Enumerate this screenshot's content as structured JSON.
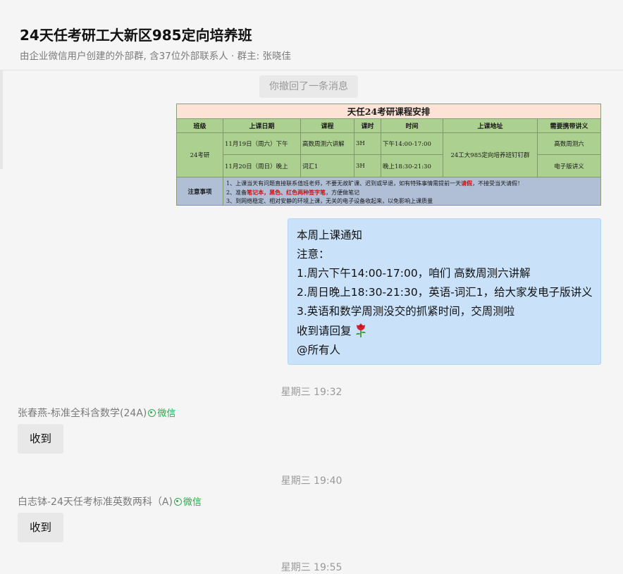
{
  "header": {
    "title": "24天任考研工大新区985定向培养班",
    "subtitle": "由企业微信用户创建的外部群, 含37位外部联系人 · 群主: 张晓佳"
  },
  "messages": {
    "revoke_notice": "你撤回了一条消息",
    "schedule": {
      "title": "天任24考研课程安排",
      "headers": [
        "班级",
        "上课日期",
        "课程",
        "课时",
        "时间",
        "上课地址",
        "需要携带讲义"
      ],
      "class_name": "24考研",
      "rows": [
        {
          "date": "11月19日（周六）下午",
          "course": "高数周测六讲解",
          "hours": "3H",
          "time": "下午14:00-17:00",
          "material": "高数周测六"
        },
        {
          "date": "11月20日（周日）晚上",
          "course": "词汇1",
          "hours": "3H",
          "time": "晚上18:30-21:30",
          "material": "电子版讲义"
        }
      ],
      "address": "24工大985定向培养班钉钉群",
      "notes_label": "注意事项",
      "note1_a": "1、上课当天有问题直接联系值班老师，不要无故旷课、迟到或早退，如有特殊事情需提前一天",
      "note1_red": "请假",
      "note1_b": "，不接受当天请假！",
      "note2_a": "2、准备",
      "note2_red": "笔记本，黑色、红色两种签字笔",
      "note2_b": "，方便做笔记",
      "note3": "3、到网络稳定、相对安静的环境上课，无关的电子设备收起来，以免影响上课质量"
    },
    "notice": {
      "lines": [
        "本周上课通知",
        "注意：",
        "1.周六下午14:00-17:00，咱们 高数周测六讲解",
        "2.周日晚上18:30-21:30，英语-词汇1，给大家发电子版讲义",
        "3.英语和数学周测没交的抓紧时间，交周测啦",
        "收到请回复",
        "@所有人"
      ],
      "rose_icon": "rose-emoji"
    },
    "time1": "星期三 19:32",
    "sender1": "张春燕-标准全科含数学(24A)",
    "wechat_tag": "微信",
    "reply1": "收到",
    "time2": "星期三 19:40",
    "sender2": "白志钵-24天任考标准英数两科（A)",
    "reply2": "收到",
    "time3": "星期三 19:55"
  },
  "colors": {
    "notice_bubble": "#c9e2fa",
    "wechat_green": "#2fa84f",
    "schedule_green": "#acd08f"
  }
}
